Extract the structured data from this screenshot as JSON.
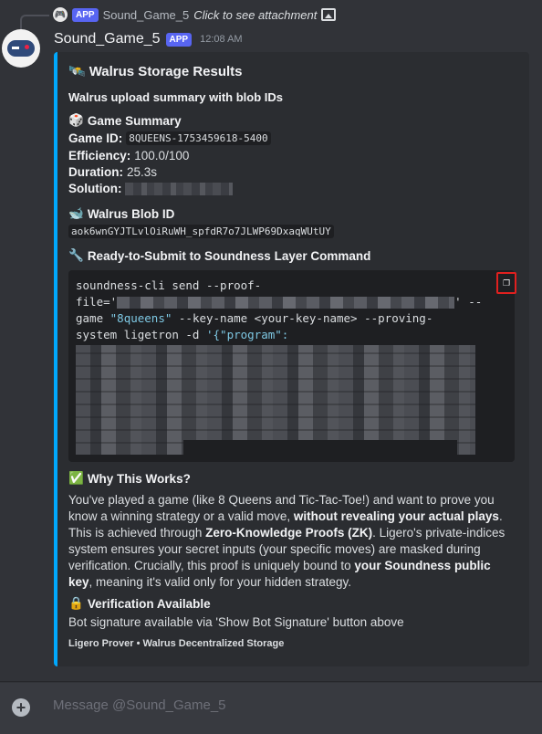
{
  "reply": {
    "app_badge": "APP",
    "name": "Sound_Game_5",
    "text": "Click to see attachment"
  },
  "message": {
    "username": "Sound_Game_5",
    "app_badge": "APP",
    "timestamp": "12:08 AM"
  },
  "embed": {
    "title_icon": "🛰️",
    "title": "Walrus Storage Results",
    "description": "Walrus upload summary with blob IDs",
    "game_summary": {
      "icon": "🎲",
      "name": "Game Summary",
      "game_id_label": "Game ID:",
      "game_id": "8QUEENS-1753459618-5400",
      "efficiency_label": "Efficiency:",
      "efficiency": "100.0/100",
      "duration_label": "Duration:",
      "duration": "25.3s",
      "solution_label": "Solution:"
    },
    "blob": {
      "icon": "🐋",
      "name": "Walrus Blob ID",
      "value": "aok6wnGYJTLvlOiRuWH_spfdR7o7JLWP69DxaqWUtUY"
    },
    "command": {
      "icon": "🔧",
      "name": "Ready-to-Submit to Soundness Layer Command",
      "line1": "soundness-cli send --proof-",
      "line2_pre": "file='",
      "line2_post": "' --",
      "line3_pre": "game ",
      "line3_str": "\"8queens\"",
      "line3_post": " --key-name <your-key-name> --proving-",
      "line4_pre": "system ligetron -d ",
      "line4_str": "'{\"program\":"
    },
    "why": {
      "icon": "✅",
      "name": "Why This Works?",
      "p1": "You've played a game (like 8 Queens and Tic-Tac-Toe!) and want to prove you know a winning strategy or a valid move, ",
      "p1_bold": "without revealing your actual plays",
      "p2": ". This is achieved through ",
      "p2_bold": "Zero-Knowledge Proofs (ZK)",
      "p3": ". Ligero's private-indices system ensures your secret inputs (your specific moves) are masked during verification. Crucially, this proof is uniquely bound to ",
      "p3_bold": "your Soundness public key",
      "p4": ", meaning it's valid only for your hidden strategy."
    },
    "verification": {
      "icon": "🔒",
      "name": "Verification Available",
      "text": "Bot signature available via 'Show Bot Signature' button above"
    },
    "footer": "Ligero Prover • Walrus Decentralized Storage"
  },
  "composer": {
    "placeholder": "Message @Sound_Game_5"
  },
  "colors": {
    "embed_accent": "#00a8fc",
    "app_badge": "#5865f2",
    "highlight_box": "#e0201f"
  }
}
